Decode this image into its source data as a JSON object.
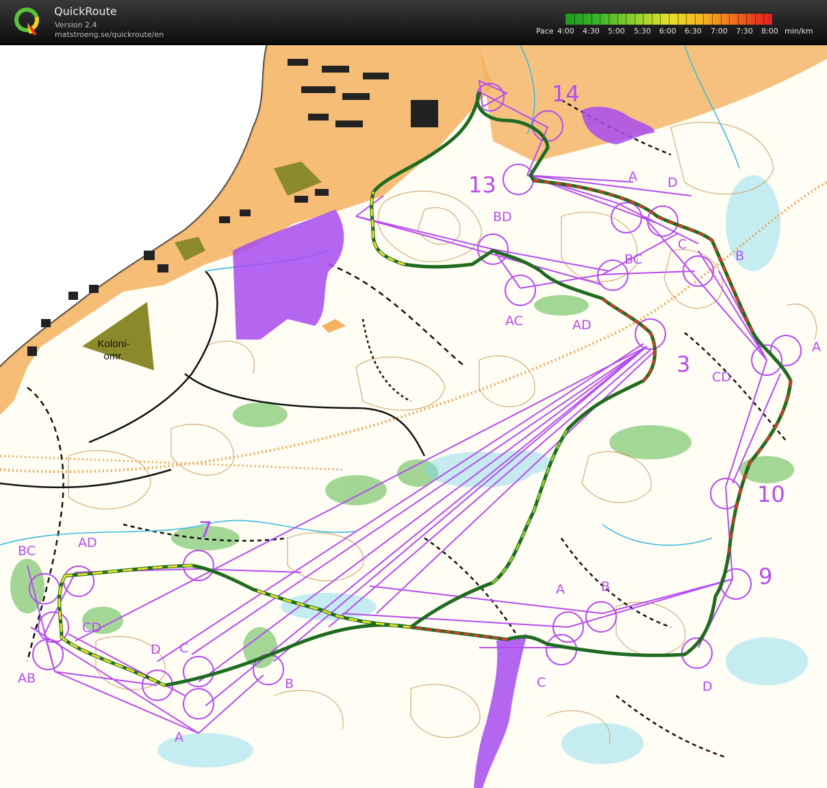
{
  "app": {
    "title": "QuickRoute",
    "version": "Version 2.4",
    "url": "matstroeng.se/quickroute/en"
  },
  "legend": {
    "pace_prefix": "Pace",
    "ticks": [
      "4:00",
      "4:30",
      "5:00",
      "5:30",
      "6:00",
      "6:30",
      "7:00",
      "7:30",
      "8:00"
    ],
    "unit": "min/km",
    "colors": [
      "#1e9a1e",
      "#3cb82c",
      "#8ed02c",
      "#e8e22a",
      "#f4b21e",
      "#f0661e",
      "#e01e1e"
    ]
  },
  "map": {
    "area_label": "Koloni-\nomr.",
    "colors": {
      "course": "#b64bf0",
      "forbidden_area": "#a84bf0",
      "contour": "#c89a5a",
      "water": "#5ac8e6",
      "path": "#111111",
      "urban": "#f0a850",
      "green": "#58b848"
    },
    "control_labels": {
      "c14": "14",
      "c13": "13",
      "c10": "10",
      "c9": "9",
      "c7": "7",
      "c3": "3",
      "bd": "BD",
      "bc_top": "BC",
      "ac": "AC",
      "ad_top": "AD",
      "a_top": "A",
      "d_top": "D",
      "c_top": "C",
      "b_top": "B",
      "a_right": "A",
      "cd_right": "CD",
      "bc_left": "BC",
      "ad_left": "AD",
      "cd_left": "CD",
      "ab_left": "AB",
      "d_bottom": "D",
      "c_bottom": "C",
      "b_bottom": "B",
      "a_bottom": "A",
      "a_mid": "A",
      "b_mid": "B",
      "c_mid": "C",
      "d_right": "D"
    }
  }
}
